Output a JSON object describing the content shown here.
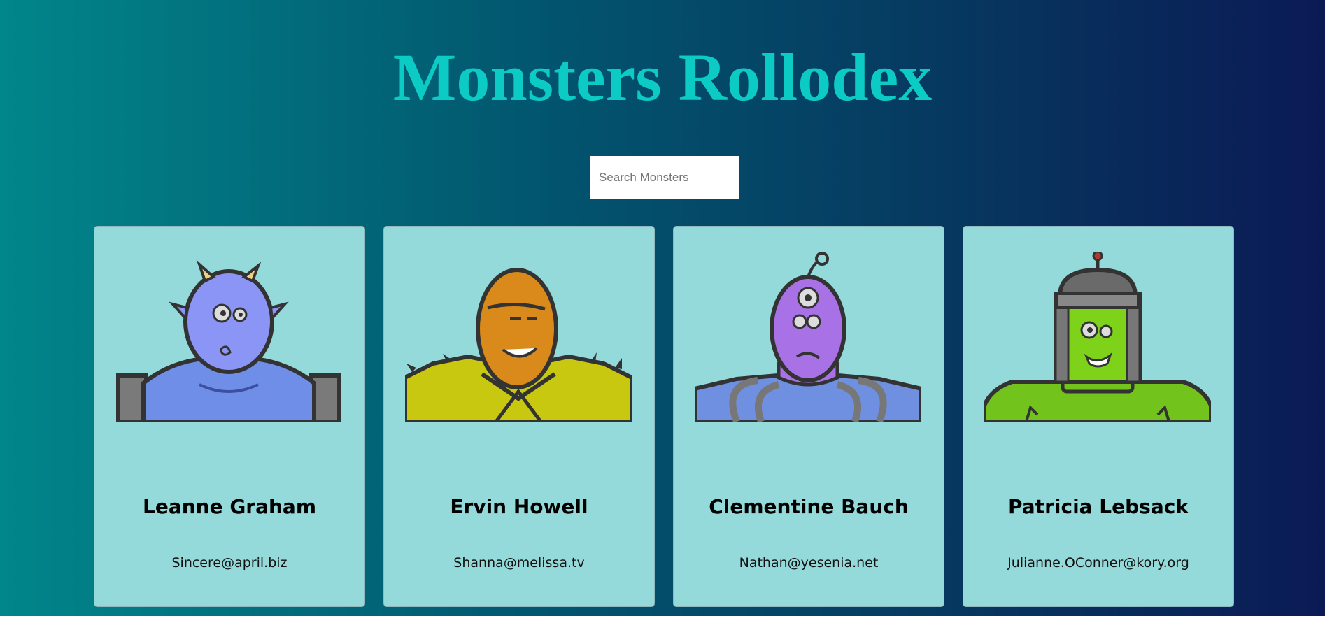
{
  "header": {
    "title": "Monsters Rollodex"
  },
  "search": {
    "placeholder": "Search Monsters",
    "value": ""
  },
  "monsters": [
    {
      "name": "Leanne Graham",
      "email": "Sincere@april.biz",
      "color": "#8b95f5",
      "body_color": "#6e8ee8",
      "avatar": "blue-horned-monster"
    },
    {
      "name": "Ervin Howell",
      "email": "Shanna@melissa.tv",
      "color": "#d98a1a",
      "body_color": "#c9c810",
      "avatar": "orange-spiky-monster"
    },
    {
      "name": "Clementine Bauch",
      "email": "Nathan@yesenia.net",
      "color": "#a872e6",
      "body_color": "#6f90e0",
      "avatar": "purple-cyclops-robot"
    },
    {
      "name": "Patricia Lebsack",
      "email": "Julianne.OConner@kory.org",
      "color": "#7ed31a",
      "body_color": "#72c41c",
      "avatar": "green-helmet-robot"
    }
  ]
}
